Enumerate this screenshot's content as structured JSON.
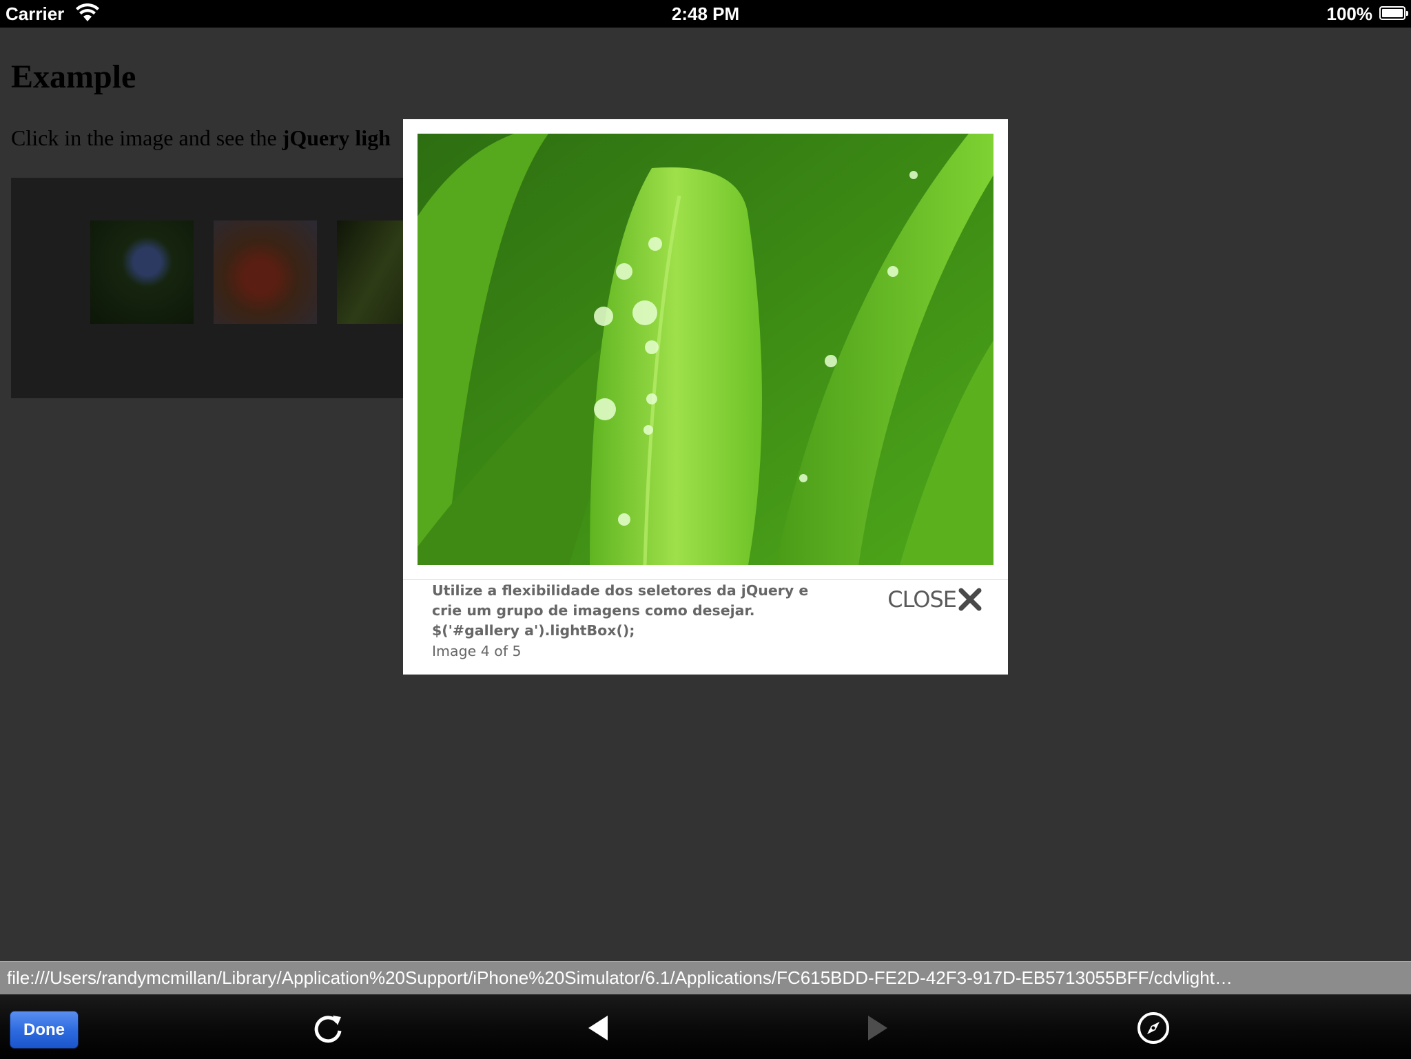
{
  "status_bar": {
    "carrier": "Carrier",
    "time": "2:48 PM",
    "battery": "100%"
  },
  "page": {
    "title": "Example",
    "intro_text": "Click in the image and see the ",
    "intro_bold": "jQuery ligh"
  },
  "lightbox": {
    "caption_line1": "Utilize a flexibilidade dos seletores da jQuery e",
    "caption_line2": "crie um grupo de imagens como desejar.",
    "caption_code": "$('#gallery a').lightBox();",
    "counter": "Image 4 of 5",
    "close_label": "CLOSE"
  },
  "url_bar": {
    "url": "file:///Users/randymcmillan/Library/Application%20Support/iPhone%20Simulator/6.1/Applications/FC615BDD-FE2D-42F3-917D-EB5713055BFF/cdvlight…"
  },
  "toolbar": {
    "done_label": "Done",
    "icons": [
      "reload-icon",
      "back-icon",
      "forward-icon",
      "safari-compass-icon"
    ]
  },
  "colors": {
    "overlay": "#333333",
    "done_button": "#2f6ce0",
    "url_bar": "#8c8c8c"
  }
}
